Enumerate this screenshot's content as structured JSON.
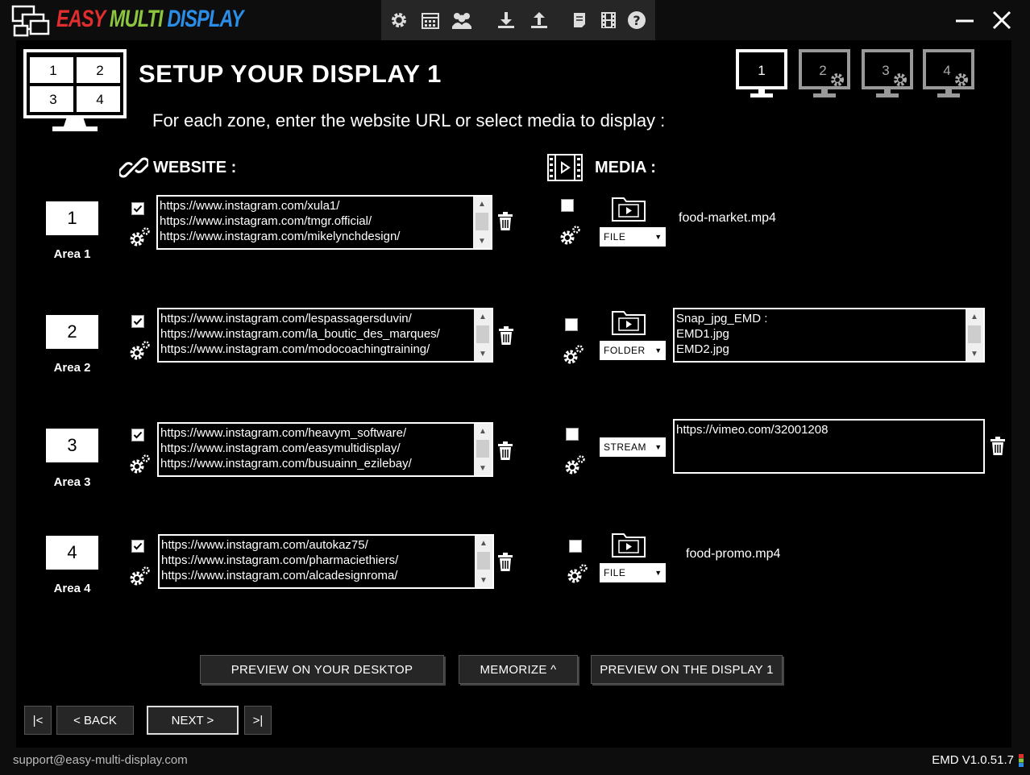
{
  "app": {
    "logo_word1": "EASY",
    "logo_word2": "MULTI",
    "logo_word3": "DISPLAY"
  },
  "toolbar": {
    "icons": [
      "gear-icon",
      "calendar-icon",
      "users-icon",
      "download-icon",
      "upload-icon",
      "notes-icon",
      "film-icon",
      "help-icon"
    ]
  },
  "page": {
    "title": "SETUP YOUR DISPLAY 1",
    "subtitle": "For each zone, enter the website URL or select media to display :",
    "layout_cells": [
      "1",
      "2",
      "3",
      "4"
    ]
  },
  "displays": [
    {
      "label": "1",
      "active": true
    },
    {
      "label": "2",
      "active": false
    },
    {
      "label": "3",
      "active": false
    },
    {
      "label": "4",
      "active": false
    }
  ],
  "sections": {
    "website": "WEBSITE :",
    "media": "MEDIA :"
  },
  "areas": [
    {
      "num": "1",
      "label": "Area 1",
      "website_checked": true,
      "urls": [
        "https://www.instagram.com/xula1/",
        "https://www.instagram.com/tmgr.official/",
        "https://www.instagram.com/mikelynchdesign/"
      ],
      "media_checked": false,
      "media_type": "FILE",
      "media_value": "food-market.mp4"
    },
    {
      "num": "2",
      "label": "Area 2",
      "website_checked": true,
      "urls": [
        "https://www.instagram.com/lespassagersduvin/",
        "https://www.instagram.com/la_boutic_des_marques/",
        "https://www.instagram.com/modocoachingtraining/"
      ],
      "media_checked": false,
      "media_type": "FOLDER",
      "media_lines": [
        "Snap_jpg_EMD :",
        "EMD1.jpg",
        "EMD2.jpg"
      ]
    },
    {
      "num": "3",
      "label": "Area 3",
      "website_checked": true,
      "urls": [
        "https://www.instagram.com/heavym_software/",
        "https://www.instagram.com/easymultidisplay/",
        "https://www.instagram.com/busuainn_ezilebay/"
      ],
      "media_checked": false,
      "media_type": "STREAM",
      "media_value": "https://vimeo.com/32001208"
    },
    {
      "num": "4",
      "label": "Area 4",
      "website_checked": true,
      "urls": [
        "https://www.instagram.com/autokaz75/",
        "https://www.instagram.com/pharmaciethiers/",
        "https://www.instagram.com/alcadesignroma/"
      ],
      "media_checked": false,
      "media_type": "FILE",
      "media_value": "food-promo.mp4"
    }
  ],
  "actions": {
    "preview_desktop": "PREVIEW ON YOUR DESKTOP",
    "memorize": "MEMORIZE ^",
    "preview_display": "PREVIEW ON THE DISPLAY 1"
  },
  "nav": {
    "first": "|<",
    "back": "< BACK",
    "next": "NEXT >",
    "last": ">|"
  },
  "footer": {
    "email": "support@easy-multi-display.com",
    "version": "EMD V1.0.51.7"
  },
  "colors": {
    "logo_red": "#e02d2d",
    "logo_green": "#8cc63f",
    "logo_blue": "#2a8de8",
    "background": "#000000",
    "panel": "#0d0d0d"
  }
}
